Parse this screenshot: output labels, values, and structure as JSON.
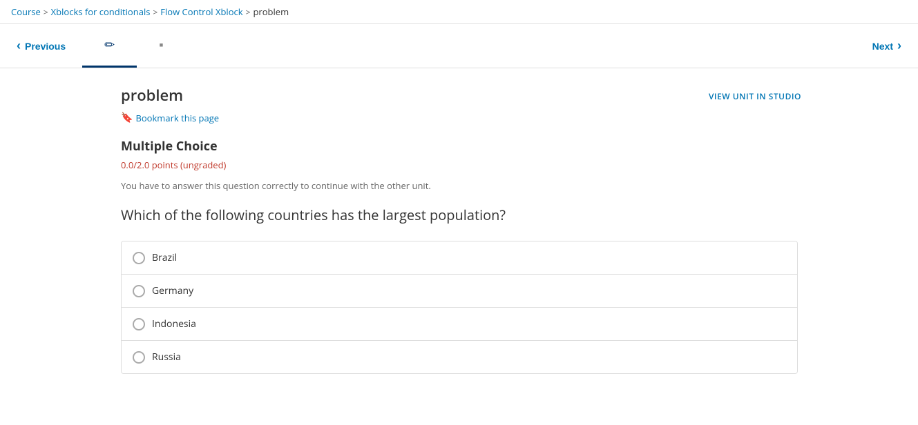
{
  "breadcrumb": {
    "items": [
      {
        "label": "Course",
        "link": true
      },
      {
        "label": "Xblocks for conditionals",
        "link": true
      },
      {
        "label": "Flow Control Xblock",
        "link": true
      },
      {
        "label": "problem",
        "link": false
      }
    ],
    "separators": [
      ">",
      ">",
      ">"
    ]
  },
  "nav": {
    "previous_label": "Previous",
    "next_label": "Next",
    "tab1_icon": "✏",
    "tab2_icon": "▪"
  },
  "header": {
    "page_title": "problem",
    "view_unit_label": "VIEW UNIT IN STUDIO",
    "bookmark_label": "Bookmark this page"
  },
  "problem": {
    "type": "Multiple Choice",
    "points": "0.0/2.0 points (ungraded)",
    "instruction": "You have to answer this question correctly to continue with the other unit.",
    "question": "Which of the following countries has the largest population?",
    "choices": [
      {
        "label": "Brazil"
      },
      {
        "label": "Germany"
      },
      {
        "label": "Indonesia"
      },
      {
        "label": "Russia"
      }
    ]
  }
}
